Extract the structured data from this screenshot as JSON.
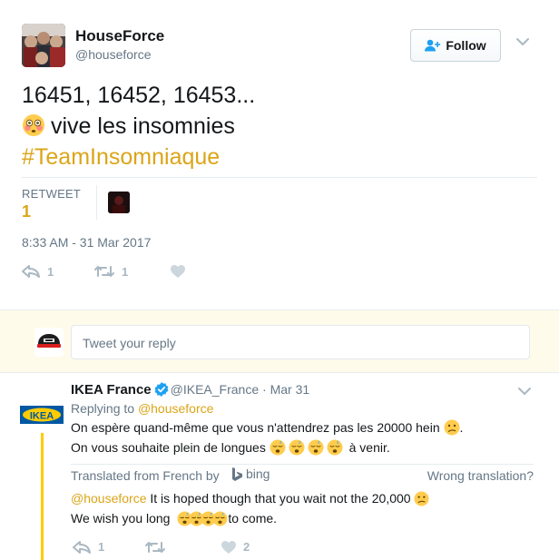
{
  "main_tweet": {
    "author_name": "HouseForce",
    "author_handle": "@houseforce",
    "follow_label": "Follow",
    "text_line1": "16451, 16452, 16453...",
    "text_line2": "vive les insomnies",
    "hashtag": "#TeamInsomniaque",
    "stats_label": "RETWEET",
    "retweet_count": "1",
    "timestamp": "8:33 AM - 31 Mar 2017",
    "actions": {
      "reply_count": "1",
      "retweet_count": "1"
    }
  },
  "reply_box": {
    "placeholder": "Tweet your reply"
  },
  "reply_tweet": {
    "author_name": "IKEA France",
    "author_handle": "@IKEA_France",
    "separator": "·",
    "date": "Mar 31",
    "replying_to_label": "Replying to",
    "replying_to_handle": "@houseforce",
    "text_line1": "On espère quand-même que vous n'attendrez pas les 20000 hein",
    "text_line2_a": "On vous souhaite plein de longues",
    "text_line2_b": "à venir.",
    "translated_from": "Translated from French by",
    "bing": "bing",
    "wrong_translation": "Wrong translation?",
    "translation_mention": "@houseforce",
    "translation_line1": "It is hoped though that you wait not the 20,000",
    "translation_line2_a": "We wish you long",
    "translation_line2_b": "to come.",
    "logo_text": "IKEA",
    "actions": {
      "reply_count": "1",
      "like_count": "2"
    }
  },
  "colors": {
    "accent": "#dba517",
    "muted": "#657786",
    "icon": "#aab8c2",
    "reply_bg": "#fffbea",
    "verified": "#1da1f2",
    "ikea_blue": "#0058a3",
    "ikea_yellow": "#ffcc00"
  },
  "icons": [
    "user-plus-icon",
    "chevron-down-icon",
    "reply-icon",
    "retweet-icon",
    "heart-icon",
    "verified-icon",
    "bing-icon",
    "flushed-emoji",
    "sleeping-emoji",
    "confused-emoji"
  ]
}
